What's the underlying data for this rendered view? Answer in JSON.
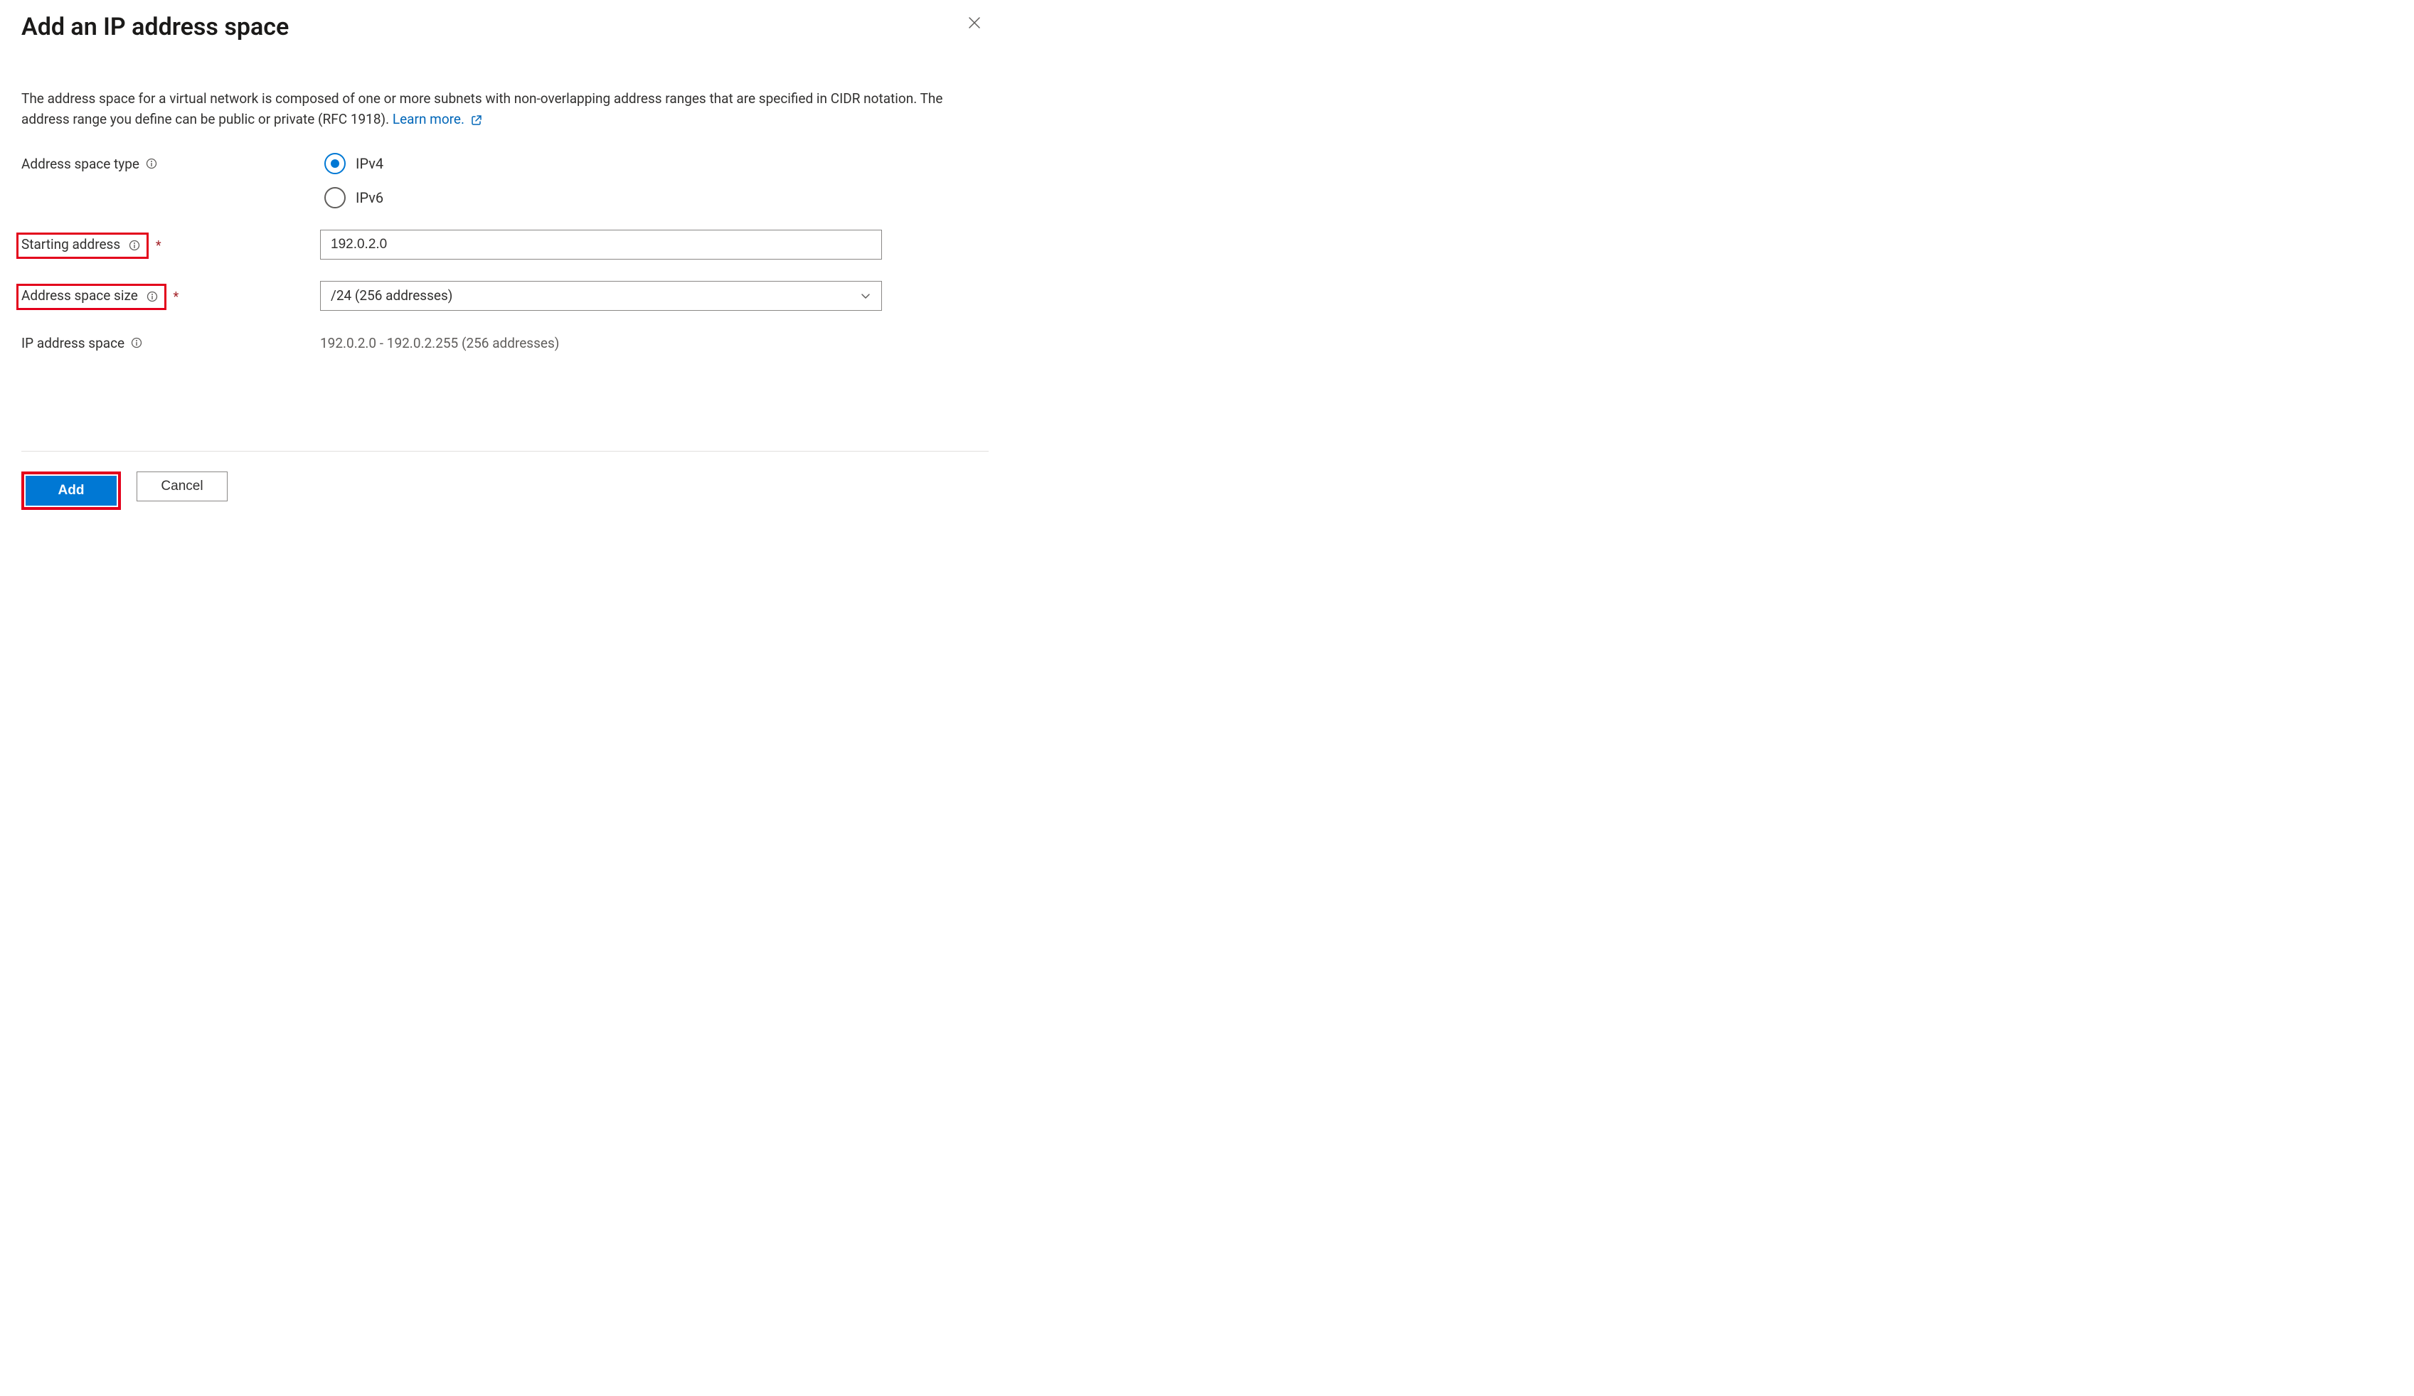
{
  "header": {
    "title": "Add an IP address space"
  },
  "description": {
    "text": "The address space for a virtual network is composed of one or more subnets with non-overlapping address ranges that are specified in CIDR notation. The address range you define can be public or private (RFC 1918).",
    "learn_more_label": "Learn more."
  },
  "form": {
    "address_space_type": {
      "label": "Address space type",
      "options": {
        "ipv4": "IPv4",
        "ipv6": "IPv6"
      },
      "selected": "ipv4"
    },
    "starting_address": {
      "label": "Starting address",
      "value": "192.0.2.0"
    },
    "address_space_size": {
      "label": "Address space size",
      "value": "/24 (256 addresses)"
    },
    "ip_address_space": {
      "label": "IP address space",
      "computed": "192.0.2.0 - 192.0.2.255 (256 addresses)"
    }
  },
  "footer": {
    "add_label": "Add",
    "cancel_label": "Cancel"
  }
}
